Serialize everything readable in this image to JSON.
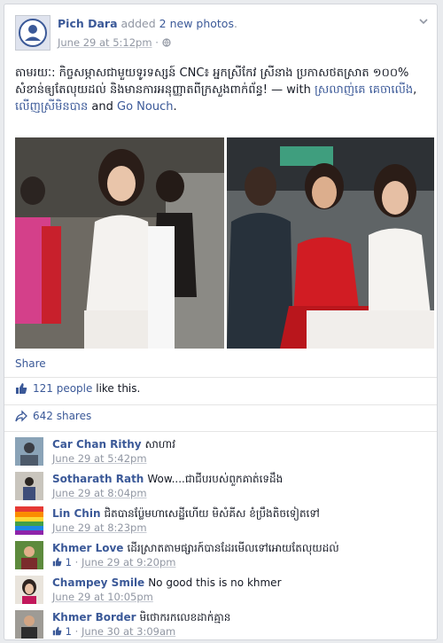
{
  "post": {
    "author": "Pich Dara",
    "action_text": "added",
    "action_link": "2 new photos",
    "period": ".",
    "date": "June 29 at 5:12pm",
    "separator": "·",
    "text": "តាមរយៈ: កិច្ចសម្ភាសជាមួយទូរទស្សន៍ CNC៖ អ្នកស្រីកែវ ស្រីនាង ប្រកាសថតស្រាត ១០០% សំខាន់ឲ្យតែលុយដល់ និងមានការអនុញ្ញាតពីក្រសួងពាក់ព័ន្ធ! — with",
    "tag1": "ស្រលាញ់គេ គេចាលើង",
    "tag_sep": ",",
    "tag2": "លើញស្រីមិនបាន",
    "and_text": "and",
    "tag3": "Go Nouch",
    "tag_end": ".",
    "share_label": "Share",
    "likes_text": "121 people",
    "likes_suffix": "like this.",
    "shares_text": "642 shares"
  },
  "comments": [
    {
      "name": "Car Chan Rithy",
      "text": "សាហាវ",
      "time": "June 29 at 5:42pm",
      "likes": "",
      "sep": ""
    },
    {
      "name": "Sotharath Rath",
      "text": "Wow....ជាជីបរបស់ពួកគាត់ទេដឹង",
      "time": "June 29 at 8:04pm",
      "likes": "",
      "sep": ""
    },
    {
      "name": "Lin Chin",
      "text": "ជិតបានប៉្លែមហាសេដ្ឋីហើយ មិសំគីស ខំប្រឹងតិចទៀតទៅ",
      "time": "June 29 at 8:23pm",
      "likes": "",
      "sep": ""
    },
    {
      "name": "Khmer Love",
      "text": "ដើរស្រាតតាមផ្សារក៍បានដែរមើលទៅអោយតែលុយដល់",
      "time": "June 29 at 9:20pm",
      "likes": "1",
      "sep": "·"
    },
    {
      "name": "Champey Smile",
      "text": "No good this is no khmer",
      "time": "June 29 at 10:05pm",
      "likes": "",
      "sep": ""
    },
    {
      "name": "Khmer Border",
      "text": "មិថោករកលេខដាក់គ្មាន",
      "time": "June 30 at 3:09am",
      "likes": "1",
      "sep": "·"
    }
  ],
  "colors": {
    "link": "#3b5998",
    "muted": "#9197a3",
    "background": "#e9ebee"
  }
}
